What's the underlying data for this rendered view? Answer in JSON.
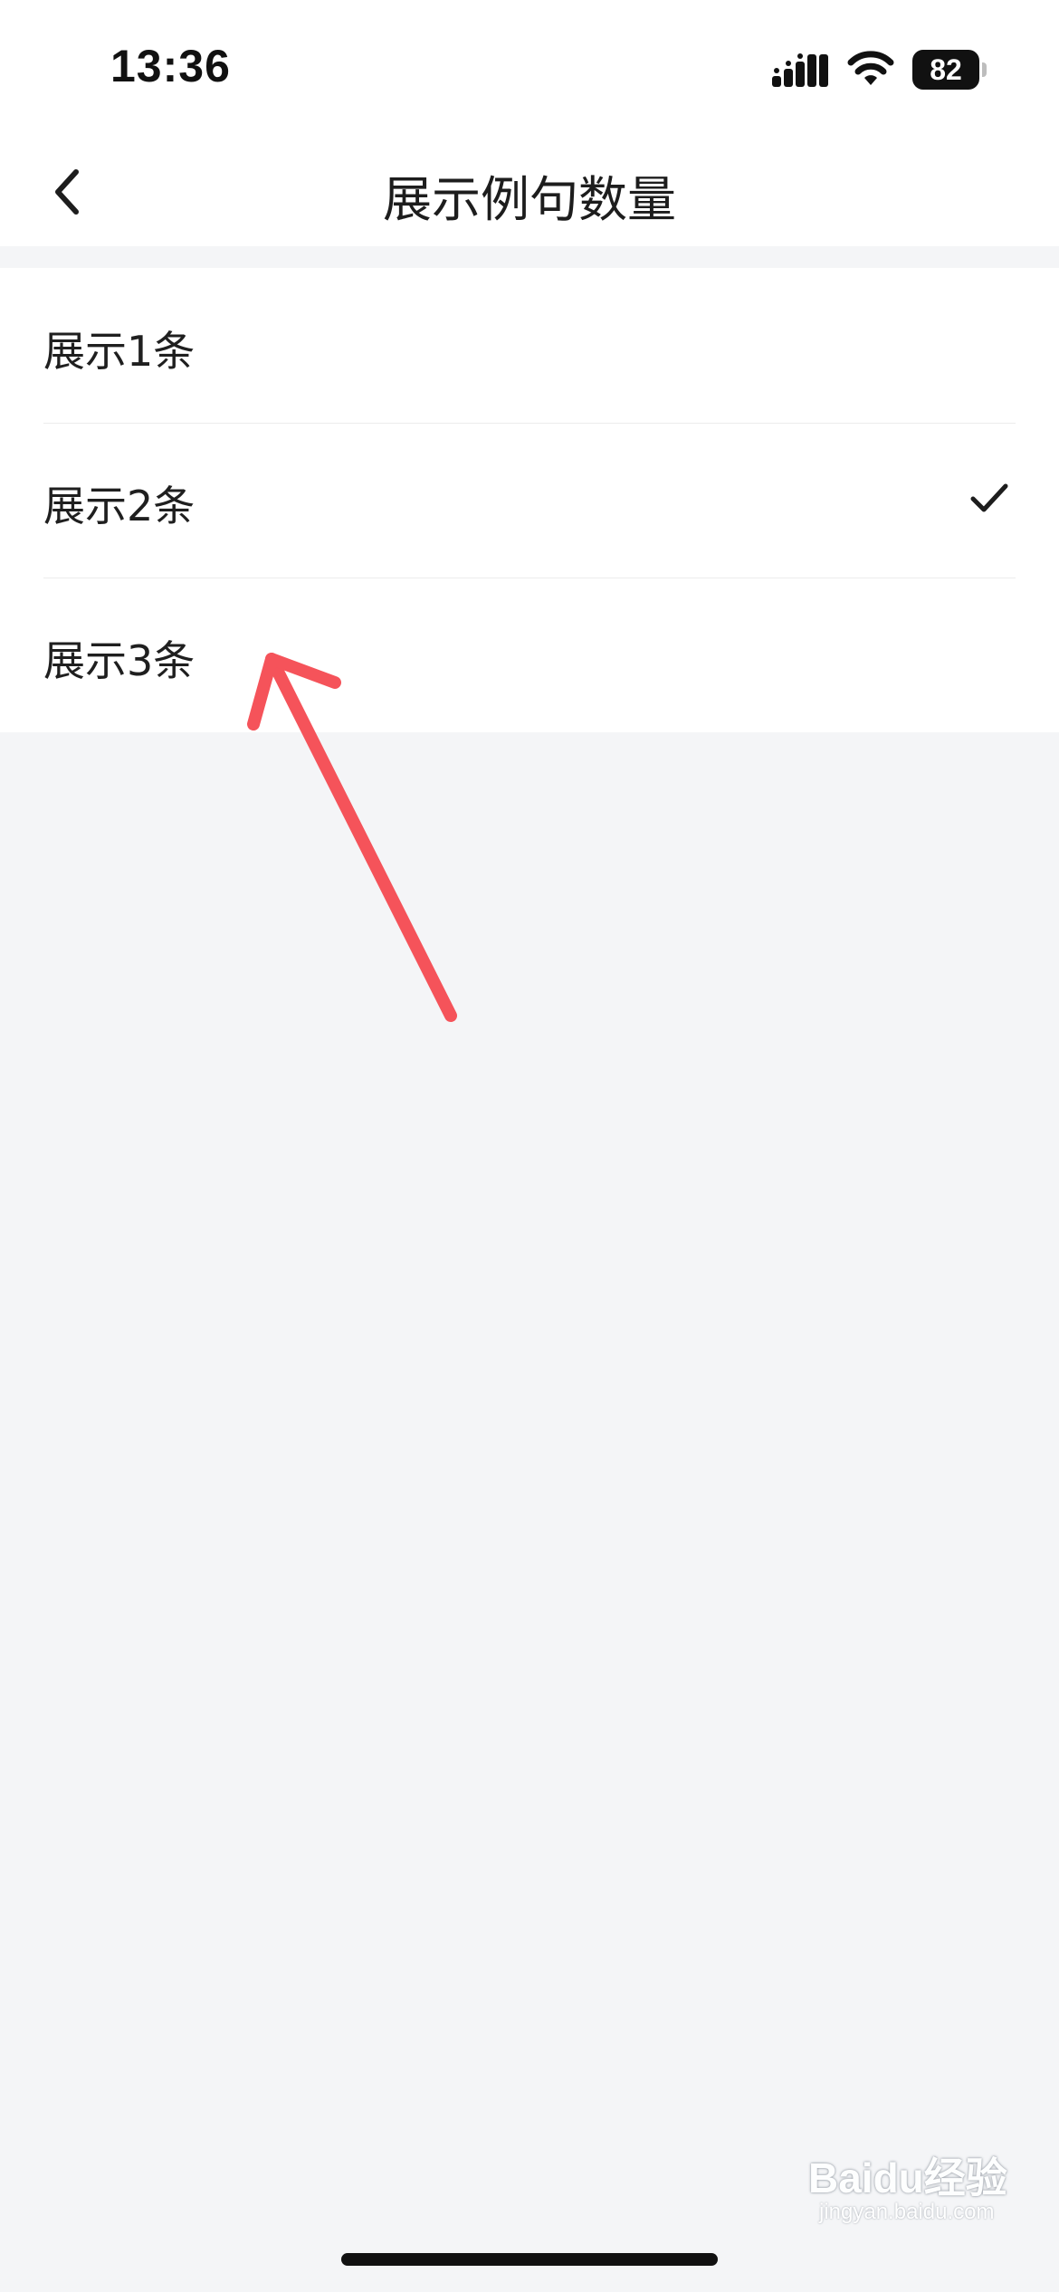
{
  "status_bar": {
    "time": "13:36",
    "battery_level": "82",
    "icons": [
      "signal-icon",
      "wifi-icon",
      "battery-icon"
    ]
  },
  "nav": {
    "title": "展示例句数量",
    "back_icon": "chevron-left-icon"
  },
  "options": [
    {
      "label": "展示1条",
      "selected": false
    },
    {
      "label": "展示2条",
      "selected": true
    },
    {
      "label": "展示3条",
      "selected": false
    }
  ],
  "annotation": {
    "type": "arrow",
    "color": "#f5535a",
    "points_to": "展示3条"
  },
  "watermark": {
    "text": "Baidu经验",
    "sub_text": "jingyan.baidu.com"
  },
  "colors": {
    "background": "#f4f5f7",
    "surface": "#ffffff",
    "text": "#1f1f1f",
    "arrow": "#f5535a"
  }
}
